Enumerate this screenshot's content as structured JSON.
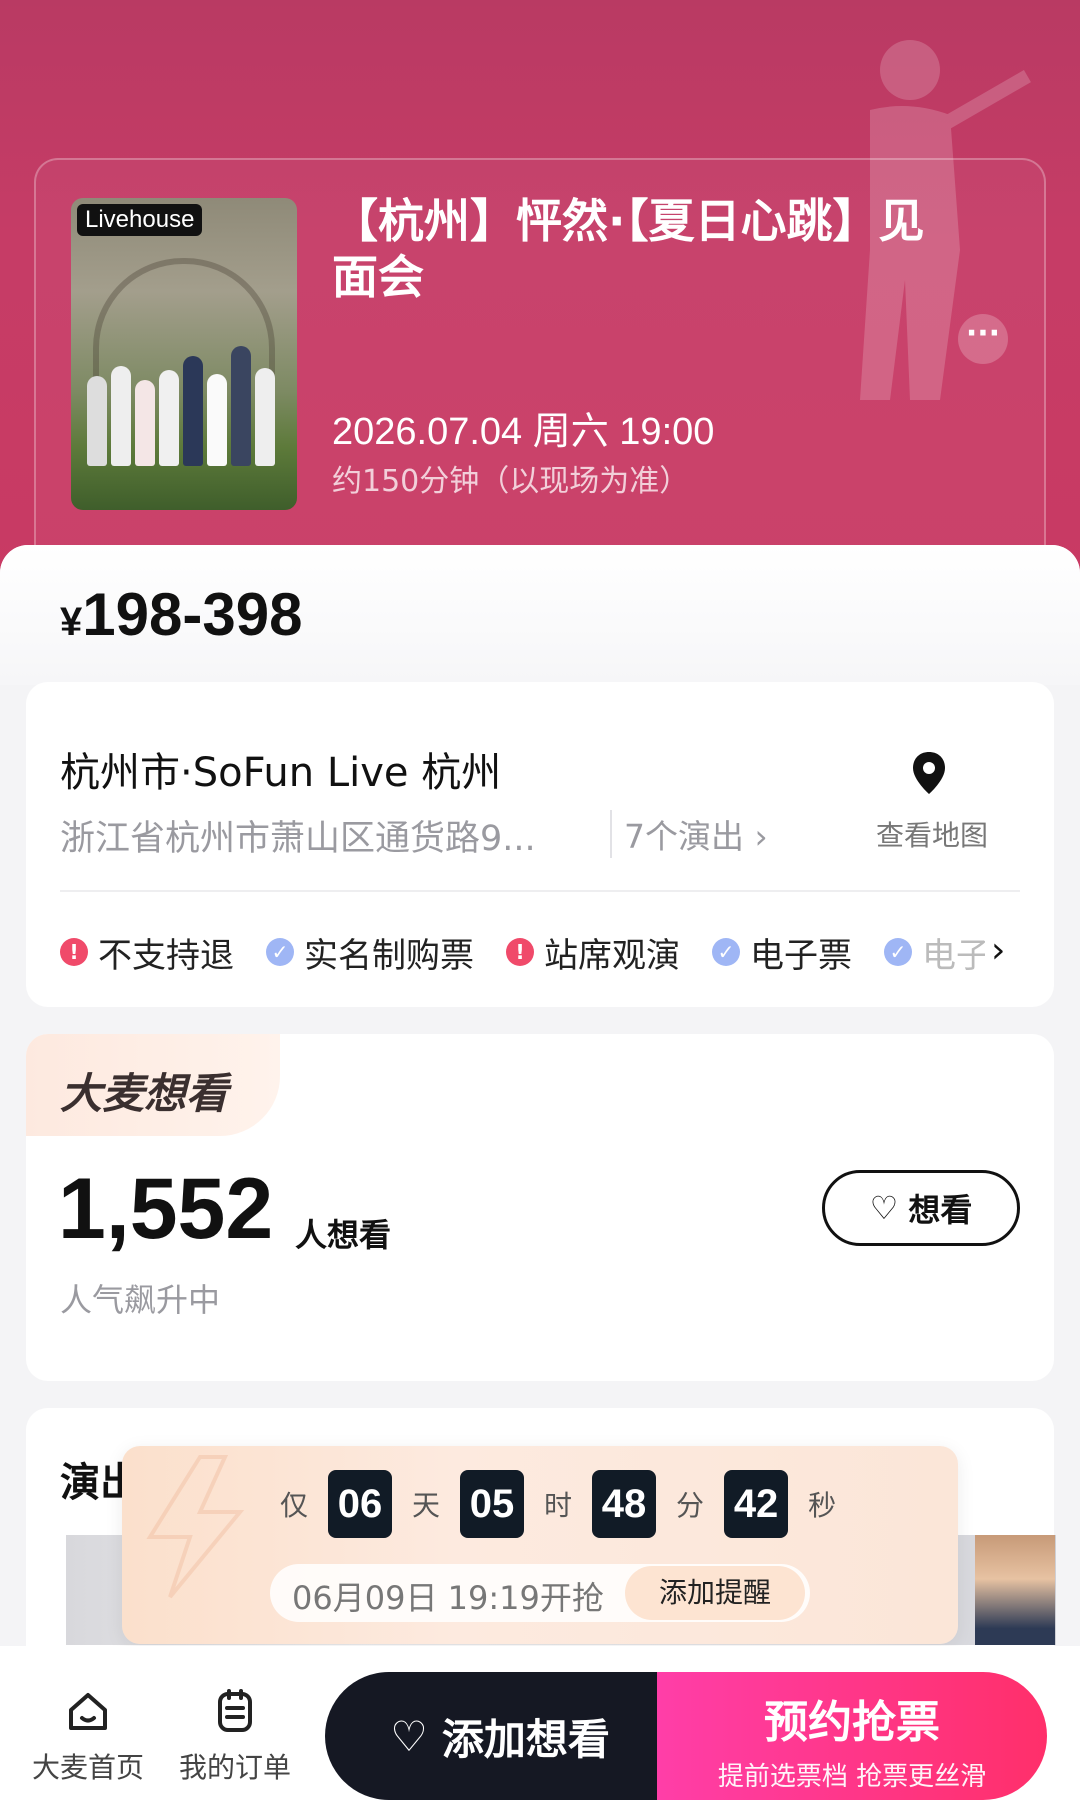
{
  "header": {
    "poster_tag": "Livehouse",
    "title": "【杭州】怦然·【夏日心跳】见面会",
    "date": "2026.07.04 周六 19:00",
    "duration": "约150分钟（以现场为准）",
    "more_icon": "more-dots-icon"
  },
  "price": {
    "currency": "¥",
    "range": "198-398"
  },
  "venue": {
    "name": "杭州市·SoFun Live 杭州",
    "address": "浙江省杭州市萧山区通货路9...",
    "shows": "7个演出 ›",
    "map_label": "查看地图",
    "tags": [
      {
        "label": "不支持退",
        "type": "warn"
      },
      {
        "label": "实名制购票",
        "type": "ok"
      },
      {
        "label": "站席观演",
        "type": "warn"
      },
      {
        "label": "电子票",
        "type": "ok"
      },
      {
        "label": "电子",
        "type": "ok"
      }
    ],
    "more_arrow": "›"
  },
  "want": {
    "badge": "大麦想看",
    "count": "1,552",
    "unit": "人想看",
    "sub": "人气飙升中",
    "button": "想看"
  },
  "show": {
    "title": "演出"
  },
  "countdown": {
    "prefix": "仅",
    "days": "06",
    "days_label": "天",
    "hours": "05",
    "hours_label": "时",
    "minutes": "48",
    "minutes_label": "分",
    "seconds": "42",
    "seconds_label": "秒",
    "open_time": "06月09日 19:19开抢",
    "remind": "添加提醒"
  },
  "bottom": {
    "home": "大麦首页",
    "orders": "我的订单",
    "add_want": "添加想看",
    "reserve": "预约抢票",
    "reserve_sub": "提前选票档 抢票更丝滑"
  },
  "colors": {
    "accent": "#c93a63",
    "cta_pink": "#ff2f6a",
    "dark": "#151823"
  }
}
